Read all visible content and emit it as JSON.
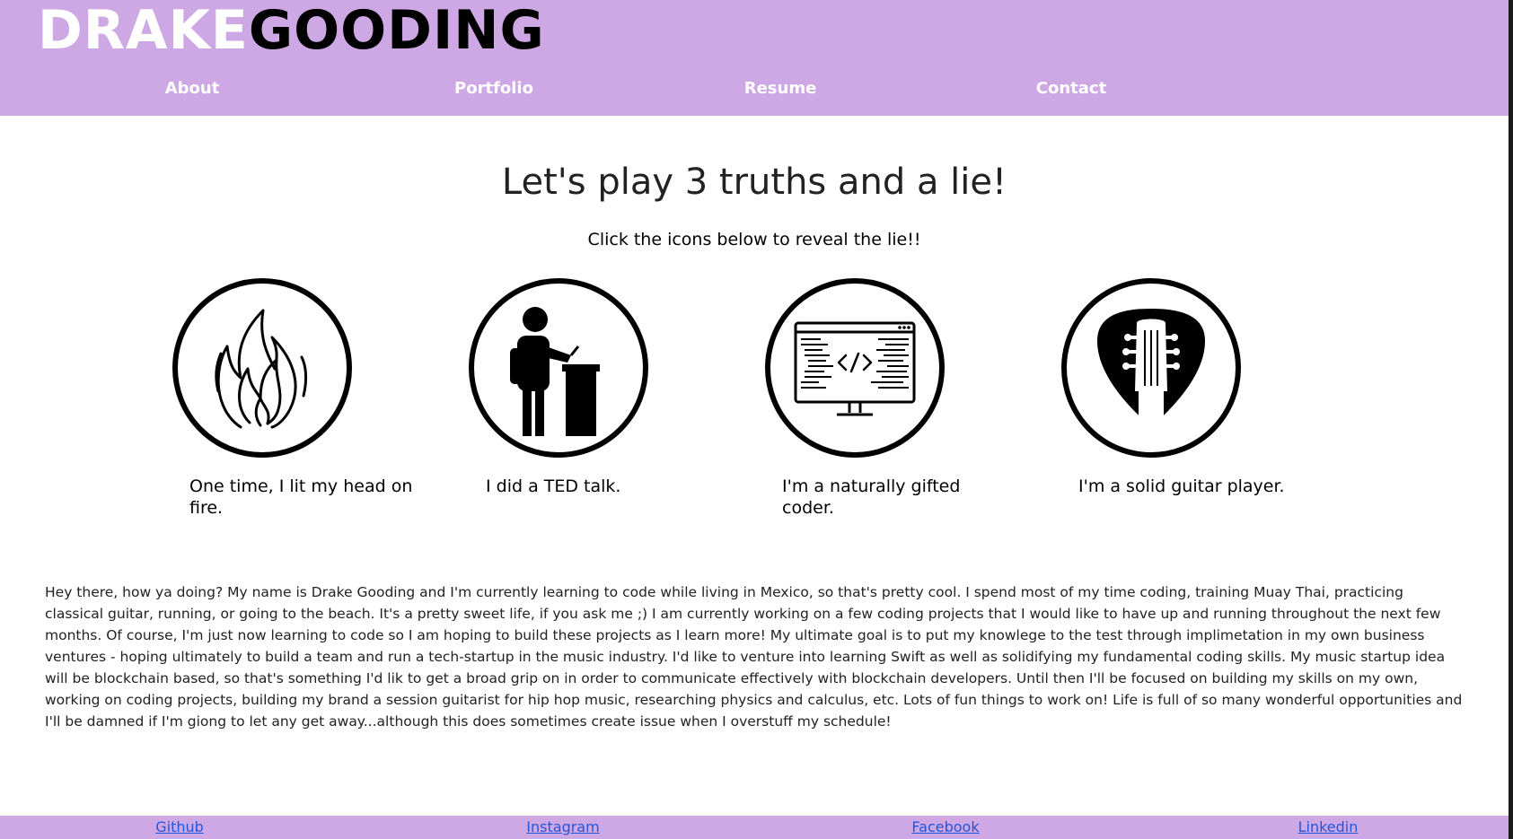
{
  "header": {
    "logo_first": "DRAKE",
    "logo_last": "GOODING",
    "nav": [
      {
        "label": "About"
      },
      {
        "label": "Portfolio"
      },
      {
        "label": "Resume"
      },
      {
        "label": "Contact"
      }
    ],
    "background_color": "#cea8e4"
  },
  "main": {
    "title": "Let's play 3 truths and a lie!",
    "subtitle": "Click the icons below to reveal the lie!!",
    "truths": [
      {
        "icon": "fire-icon",
        "caption": "One time, I lit my head on fire."
      },
      {
        "icon": "speaker-podium-icon",
        "caption": "I did a TED talk."
      },
      {
        "icon": "code-monitor-icon",
        "caption": "I'm a naturally gifted coder."
      },
      {
        "icon": "guitar-pick-icon",
        "caption": "I'm a solid guitar player."
      }
    ],
    "bio": "Hey there, how ya doing? My name is Drake Gooding and I'm currently learning to code while living in Mexico, so that's pretty cool. I spend most of my time coding, training Muay Thai, practicing classical guitar, running, or going to the beach. It's a pretty sweet life, if you ask me ;) I am currently working on a few coding projects that I would like to have up and running throughout the next few months. Of course, I'm just now learning to code so I am hoping to build these projects as I learn more! My ultimate goal is to put my knowlege to the test through implimetation in my own business ventures - hoping ultimately to build a team and run a tech-startup in the music industry. I'd like to venture into learning Swift as well as solidifying my fundamental coding skills. My music startup idea will be blockchain based, so that's something I'd lik to get a broad grip on in order to communicate effectively with blockchain developers. Until then I'll be focused on building my skills on my own, working on coding projects, building my brand a session guitarist for hip hop music, researching physics and calculus, etc. Lots of fun things to work on! Life is full of so many wonderful opportunities and I'll be damned if I'm giong to let any get away...although this does sometimes create issue when I overstuff my schedule!"
  },
  "footer": {
    "links": [
      {
        "label": "Github"
      },
      {
        "label": "Instagram"
      },
      {
        "label": "Facebook"
      },
      {
        "label": "Linkedin"
      }
    ],
    "link_color": "#2255dd"
  }
}
